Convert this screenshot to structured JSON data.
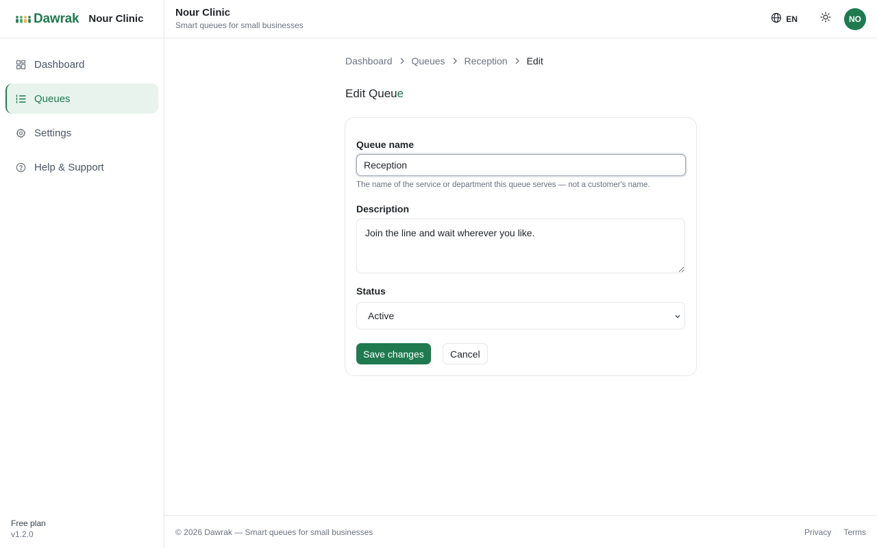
{
  "brand": {
    "name": "Dawrak",
    "org": "Nour Clinic",
    "accent": "#1f7a4f"
  },
  "sidebar": {
    "items": [
      {
        "label": "Dashboard",
        "icon": "dashboard-grid-icon",
        "active": false
      },
      {
        "label": "Queues",
        "icon": "list-icon",
        "active": true
      },
      {
        "label": "Settings",
        "icon": "gear-icon",
        "active": false
      },
      {
        "label": "Help & Support",
        "icon": "help-circle-icon",
        "active": false
      }
    ],
    "plan": "Free plan",
    "version": "v1.2.0"
  },
  "header": {
    "title": "Nour Clinic",
    "subtitle": "Smart queues for small businesses",
    "language": "EN",
    "language_icon": "globe-icon",
    "theme_icon": "sun-icon",
    "avatar_initials": "NO"
  },
  "breadcrumb": [
    "Dashboard",
    "Queues",
    "Reception",
    "Edit"
  ],
  "page": {
    "title_main": "Edit Queu",
    "title_tail": "e"
  },
  "form": {
    "queue_name_label": "Queue name",
    "queue_name_value": "Reception",
    "queue_name_hint": "The name of the service or department this queue serves — not a customer's name.",
    "description_label": "Description",
    "description_value": "Join the line and wait wherever you like.",
    "status_label": "Status",
    "status_value": "Active",
    "save_label": "Save changes",
    "cancel_label": "Cancel"
  },
  "footer": {
    "copyright": "© 2026 Dawrak — Smart queues for small businesses",
    "links": [
      "Privacy",
      "Terms"
    ]
  }
}
